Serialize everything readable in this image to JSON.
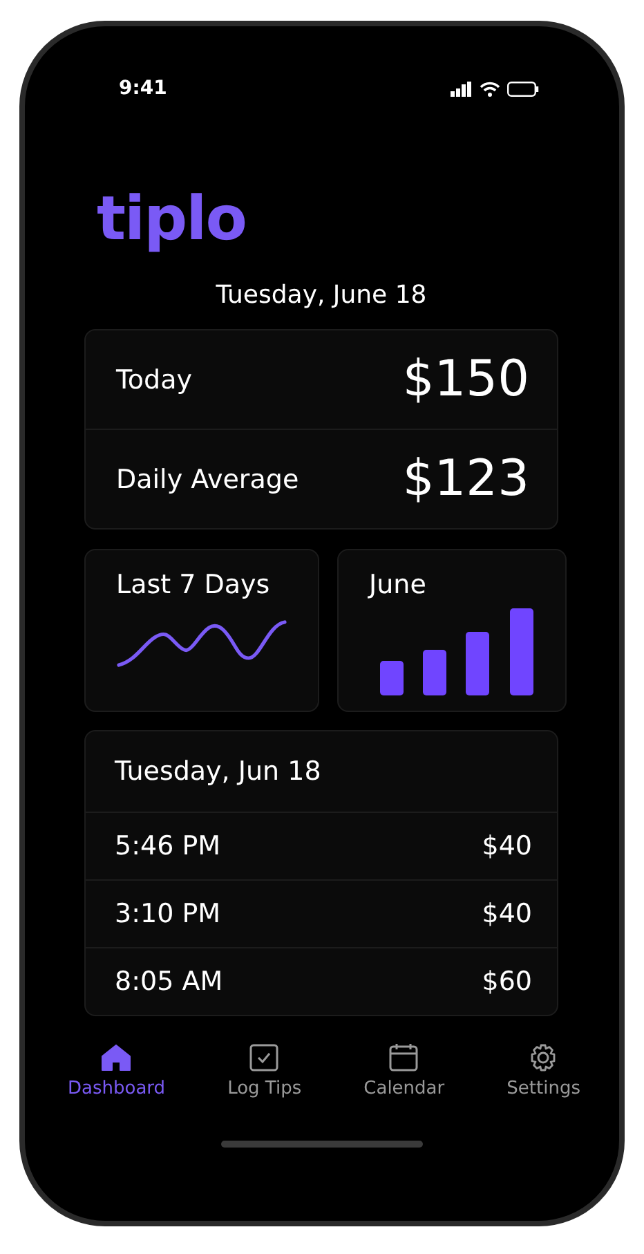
{
  "status_bar": {
    "time": "9:41"
  },
  "app": {
    "logo": "tiplo"
  },
  "date": "Tuesday, June 18",
  "summary": [
    {
      "label": "Today",
      "value": "$150"
    },
    {
      "label": "Daily Average",
      "value": "$123"
    }
  ],
  "charts": [
    {
      "kind": "wave",
      "title": "Last 7 Days"
    },
    {
      "kind": "bars",
      "title": "June"
    }
  ],
  "entries": {
    "heading": "Tuesday, Jun 18",
    "rows": [
      {
        "time": "5:46 PM",
        "amount": "$40"
      },
      {
        "time": "3:10 PM",
        "amount": "$40"
      },
      {
        "time": "8:05 AM",
        "amount": "$60"
      }
    ]
  },
  "tab_bar": [
    {
      "kind": "home",
      "label": "Dashboard",
      "selected": true
    },
    {
      "kind": "check",
      "label": "Log Tips",
      "selected": false
    },
    {
      "kind": "calendar",
      "label": "Calendar",
      "selected": false
    },
    {
      "kind": "gear",
      "label": "Settings",
      "selected": false
    }
  ]
}
